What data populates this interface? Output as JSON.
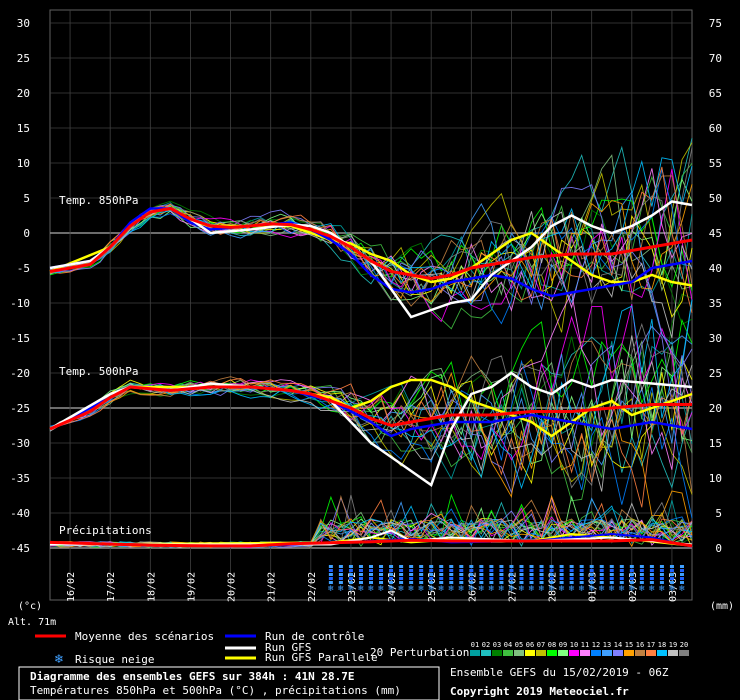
{
  "chart_data": {
    "type": "line",
    "left_axis": {
      "ticks": [
        30,
        25,
        20,
        15,
        10,
        5,
        0,
        -5,
        -10,
        -15,
        -20,
        -25,
        -30,
        -35,
        -40,
        -45
      ],
      "range": [
        -45,
        30
      ]
    },
    "right_axis": {
      "ticks": [
        75,
        70,
        65,
        60,
        55,
        50,
        45,
        40,
        35,
        30,
        25,
        20,
        15,
        10,
        5,
        0
      ]
    },
    "x_ticks": [
      "16/02",
      "17/02",
      "18/02",
      "19/02",
      "20/02",
      "21/02",
      "22/02",
      "23/02",
      "24/02",
      "25/02",
      "26/02",
      "27/02",
      "28/02",
      "01/03",
      "02/03",
      "03/03"
    ],
    "left_unit": "(°c)",
    "right_unit": "(mm)",
    "altitude": "Alt. 71m",
    "panels": {
      "t850": "Temp. 850hPa",
      "t500": "Temp. 500hPa",
      "precip": "Précipitations"
    },
    "series": [
      {
        "name": "Moyenne des scénarios",
        "color": "#ff0000",
        "t850": [
          [
            0,
            -5.5
          ],
          [
            2,
            -4.5
          ],
          [
            3,
            -2
          ],
          [
            4,
            1
          ],
          [
            5,
            3
          ],
          [
            6,
            3.5
          ],
          [
            7,
            2
          ],
          [
            8,
            1
          ],
          [
            9,
            0.8
          ],
          [
            10,
            1
          ],
          [
            11,
            1.3
          ],
          [
            12,
            1.2
          ],
          [
            13,
            0.5
          ],
          [
            14,
            -0.5
          ],
          [
            15,
            -2
          ],
          [
            16,
            -4
          ],
          [
            17,
            -5.5
          ],
          [
            18,
            -6
          ],
          [
            19,
            -6.5
          ],
          [
            20,
            -6
          ],
          [
            21,
            -5
          ],
          [
            22,
            -4.5
          ],
          [
            24,
            -3.5
          ],
          [
            26,
            -3
          ],
          [
            28,
            -3
          ],
          [
            30,
            -2
          ],
          [
            32,
            -1
          ]
        ],
        "t500": [
          [
            0,
            -28
          ],
          [
            2,
            -25.5
          ],
          [
            3,
            -23.5
          ],
          [
            4,
            -22
          ],
          [
            6,
            -22.5
          ],
          [
            8,
            -22
          ],
          [
            10,
            -22
          ],
          [
            12,
            -22.5
          ],
          [
            13,
            -23
          ],
          [
            14,
            -24
          ],
          [
            15,
            -25
          ],
          [
            16,
            -26.5
          ],
          [
            17,
            -27.5
          ],
          [
            18,
            -27
          ],
          [
            20,
            -26
          ],
          [
            22,
            -26
          ],
          [
            24,
            -25.5
          ],
          [
            26,
            -25.5
          ],
          [
            28,
            -25
          ],
          [
            30,
            -24.5
          ],
          [
            32,
            -24.5
          ]
        ],
        "precip": [
          [
            0,
            0.8
          ],
          [
            5,
            0.4
          ],
          [
            8,
            0.3
          ],
          [
            10,
            0.3
          ],
          [
            12,
            0.6
          ],
          [
            16,
            0.9
          ],
          [
            18,
            1.1
          ],
          [
            20,
            1
          ],
          [
            24,
            1
          ],
          [
            28,
            1
          ],
          [
            30,
            1.2
          ],
          [
            32,
            0.3
          ]
        ]
      },
      {
        "name": "Run de contrôle",
        "color": "#0000ff",
        "t850": [
          [
            0,
            -5
          ],
          [
            2,
            -4
          ],
          [
            3,
            -2
          ],
          [
            4,
            1.5
          ],
          [
            5,
            3.5
          ],
          [
            6,
            3.5
          ],
          [
            7,
            1.5
          ],
          [
            8,
            0.5
          ],
          [
            10,
            1
          ],
          [
            12,
            1.5
          ],
          [
            13,
            0.5
          ],
          [
            14,
            -1
          ],
          [
            15,
            -3
          ],
          [
            16,
            -6
          ],
          [
            17,
            -8
          ],
          [
            18,
            -8.5
          ],
          [
            19,
            -8
          ],
          [
            20,
            -7
          ],
          [
            22,
            -6
          ],
          [
            23,
            -6.5
          ],
          [
            24,
            -8
          ],
          [
            25,
            -9
          ],
          [
            26,
            -8.5
          ],
          [
            27,
            -8
          ],
          [
            28,
            -7.5
          ],
          [
            29,
            -7
          ],
          [
            30,
            -5
          ],
          [
            32,
            -4
          ]
        ],
        "t500": [
          [
            0,
            -28
          ],
          [
            3,
            -23.5
          ],
          [
            4,
            -22
          ],
          [
            6,
            -22.5
          ],
          [
            8,
            -22
          ],
          [
            10,
            -22
          ],
          [
            12,
            -22.5
          ],
          [
            14,
            -24
          ],
          [
            16,
            -27
          ],
          [
            17,
            -29
          ],
          [
            18,
            -28
          ],
          [
            20,
            -27
          ],
          [
            22,
            -27
          ],
          [
            24,
            -26
          ],
          [
            26,
            -27
          ],
          [
            28,
            -28
          ],
          [
            30,
            -27
          ],
          [
            32,
            -28
          ]
        ],
        "precip": [
          [
            0,
            0.6
          ],
          [
            12,
            0.4
          ],
          [
            16,
            1
          ],
          [
            18,
            1.3
          ],
          [
            20,
            0.8
          ],
          [
            24,
            1
          ],
          [
            28,
            2
          ],
          [
            30,
            1.5
          ],
          [
            32,
            0.2
          ]
        ]
      },
      {
        "name": "Run GFS",
        "color": "#ffffff",
        "t850": [
          [
            0,
            -5
          ],
          [
            2,
            -4
          ],
          [
            3,
            -2
          ],
          [
            4,
            1
          ],
          [
            5,
            3
          ],
          [
            6,
            3.5
          ],
          [
            7,
            2
          ],
          [
            8,
            0
          ],
          [
            10,
            0.5
          ],
          [
            12,
            1.2
          ],
          [
            13,
            1
          ],
          [
            14,
            0
          ],
          [
            15,
            -2
          ],
          [
            16,
            -4
          ],
          [
            17,
            -8
          ],
          [
            18,
            -12
          ],
          [
            19,
            -11
          ],
          [
            20,
            -10
          ],
          [
            21,
            -9.5
          ],
          [
            22,
            -6
          ],
          [
            23,
            -4
          ],
          [
            24,
            -2
          ],
          [
            25,
            1
          ],
          [
            26,
            2.5
          ],
          [
            27,
            1
          ],
          [
            28,
            0
          ],
          [
            29,
            1
          ],
          [
            30,
            2.5
          ],
          [
            31,
            4.5
          ],
          [
            32,
            4
          ]
        ],
        "t500": [
          [
            0,
            -28
          ],
          [
            3,
            -23
          ],
          [
            4,
            -22
          ],
          [
            6,
            -22.5
          ],
          [
            8,
            -21.5
          ],
          [
            10,
            -22
          ],
          [
            12,
            -22.5
          ],
          [
            13,
            -23
          ],
          [
            14,
            -24
          ],
          [
            15,
            -27
          ],
          [
            16,
            -30
          ],
          [
            17,
            -32
          ],
          [
            18,
            -34
          ],
          [
            19,
            -36
          ],
          [
            20,
            -28
          ],
          [
            21,
            -23
          ],
          [
            22,
            -22
          ],
          [
            23,
            -20
          ],
          [
            24,
            -22
          ],
          [
            25,
            -23
          ],
          [
            26,
            -21
          ],
          [
            27,
            -22
          ],
          [
            28,
            -21
          ],
          [
            30,
            -21.5
          ],
          [
            32,
            -22
          ]
        ],
        "precip": [
          [
            0,
            0.5
          ],
          [
            14,
            0.5
          ],
          [
            16,
            1.5
          ],
          [
            17,
            2.5
          ],
          [
            18,
            1
          ],
          [
            20,
            1.5
          ],
          [
            24,
            1
          ],
          [
            28,
            1.5
          ],
          [
            32,
            0.5
          ]
        ]
      },
      {
        "name": "Run GFS Parallele",
        "color": "#ffff00",
        "t850": [
          [
            0,
            -5.5
          ],
          [
            3,
            -2
          ],
          [
            4,
            1
          ],
          [
            5,
            3
          ],
          [
            6,
            3.5
          ],
          [
            7,
            1.5
          ],
          [
            8,
            1
          ],
          [
            10,
            1
          ],
          [
            12,
            1
          ],
          [
            14,
            -1
          ],
          [
            15,
            -1.5
          ],
          [
            16,
            -3
          ],
          [
            17,
            -4
          ],
          [
            18,
            -6
          ],
          [
            19,
            -7
          ],
          [
            20,
            -6.5
          ],
          [
            21,
            -5
          ],
          [
            22,
            -3
          ],
          [
            23,
            -1
          ],
          [
            24,
            0
          ],
          [
            25,
            -2
          ],
          [
            26,
            -4
          ],
          [
            27,
            -6
          ],
          [
            28,
            -7
          ],
          [
            29,
            -7
          ],
          [
            30,
            -6
          ],
          [
            31,
            -7
          ],
          [
            32,
            -7.5
          ]
        ],
        "t500": [
          [
            0,
            -28
          ],
          [
            3,
            -23.5
          ],
          [
            4,
            -22
          ],
          [
            8,
            -22
          ],
          [
            10,
            -22
          ],
          [
            12,
            -22.5
          ],
          [
            14,
            -23.5
          ],
          [
            15,
            -25
          ],
          [
            16,
            -24
          ],
          [
            17,
            -22
          ],
          [
            18,
            -21
          ],
          [
            19,
            -21
          ],
          [
            20,
            -22
          ],
          [
            21,
            -24
          ],
          [
            22,
            -25
          ],
          [
            23,
            -26
          ],
          [
            24,
            -27
          ],
          [
            25,
            -29
          ],
          [
            26,
            -27
          ],
          [
            27,
            -25
          ],
          [
            28,
            -24
          ],
          [
            29,
            -26
          ],
          [
            30,
            -25
          ],
          [
            31,
            -24
          ],
          [
            32,
            -23
          ]
        ],
        "precip": [
          [
            0,
            0.5
          ],
          [
            14,
            0.8
          ],
          [
            16,
            1.5
          ],
          [
            18,
            0.8
          ],
          [
            20,
            1.2
          ],
          [
            24,
            1
          ],
          [
            26,
            2
          ],
          [
            28,
            1.5
          ],
          [
            32,
            0.3
          ]
        ]
      }
    ],
    "perturbation_count": 20,
    "perturbation_colors": [
      "#00a0a0",
      "#20c0c0",
      "#008000",
      "#40c040",
      "#80c080",
      "#ffff00",
      "#c0c000",
      "#00ff00",
      "#80ff80",
      "#ff00ff",
      "#ff80ff",
      "#0080ff",
      "#40a0ff",
      "#8080ff",
      "#ffa000",
      "#c08040",
      "#ff8040",
      "#00c0ff",
      "#c0c0c0",
      "#808080"
    ],
    "snow_risk_label": "Risque neige",
    "perturbations_label": "20 Perturbations",
    "perturbation_numbers": [
      "01",
      "02",
      "03",
      "04",
      "05",
      "06",
      "07",
      "08",
      "09",
      "10",
      "11",
      "12",
      "13",
      "14",
      "15",
      "16",
      "17",
      "18",
      "19",
      "20"
    ]
  },
  "footer": {
    "title": "Diagramme des ensembles GEFS sur 384h : 41N 28.7E",
    "subtitle": "Températures 850hPa et 500hPa (°C) , précipitations (mm)",
    "run": "Ensemble GEFS du 15/02/2019 - 06Z",
    "copyright": "Copyright 2019 Meteociel.fr"
  }
}
